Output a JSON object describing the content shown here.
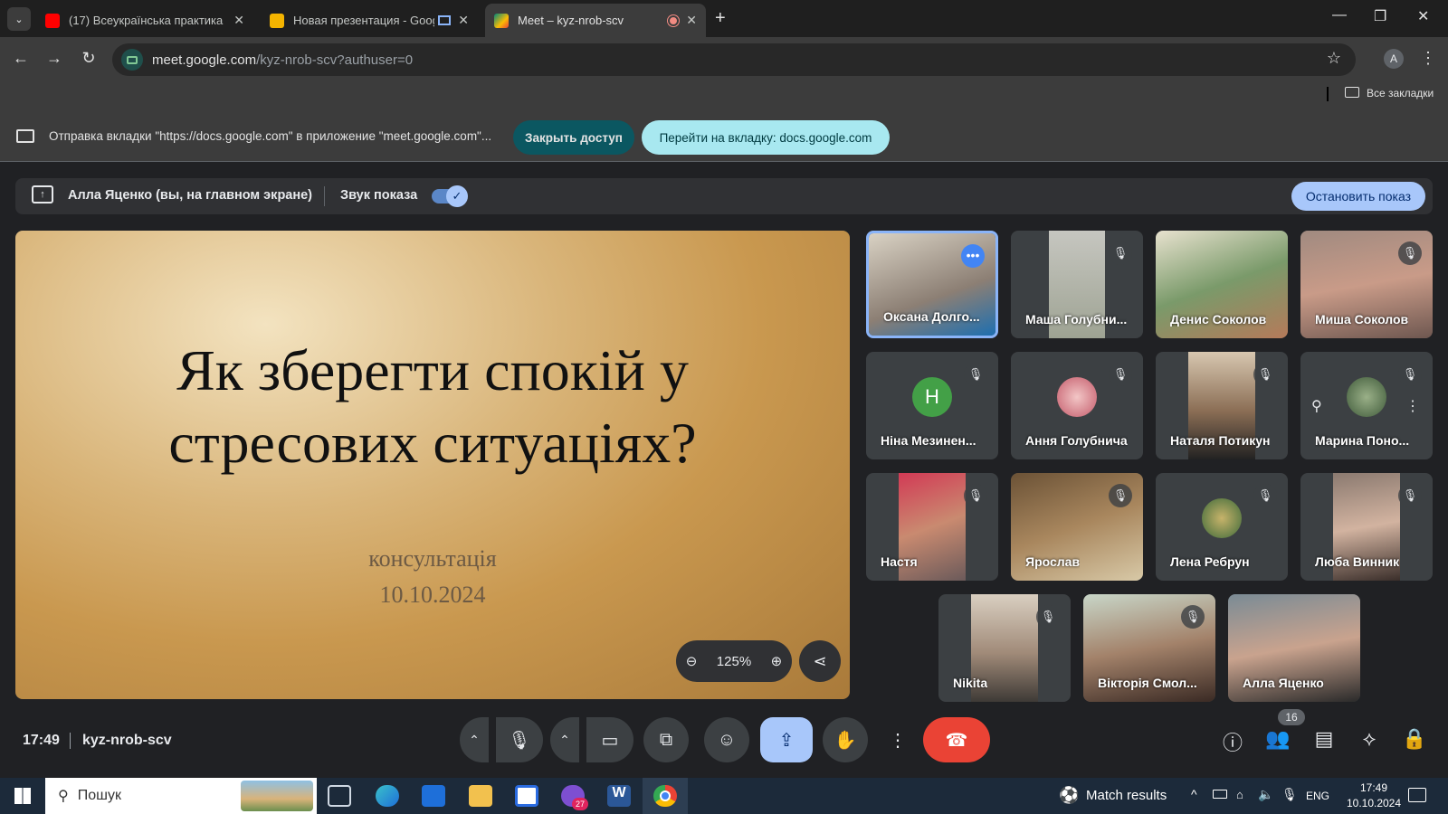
{
  "browser": {
    "tabs": [
      {
        "title": "(17) Всеукраїнська практика «",
        "icon": "youtube-icon",
        "color": "#ff0000"
      },
      {
        "title": "Новая презентация - Goog",
        "icon": "slides-icon",
        "color": "#f4b400"
      },
      {
        "title": "Meet – kyz-nrob-scv",
        "icon": "meet-icon",
        "color": "#00897b"
      }
    ],
    "url_host": "meet.google.com",
    "url_path": "/kyz-nrob-scv?authuser=0",
    "profile_initial": "A",
    "bookmarks_label": "Все закладки"
  },
  "share_banner": {
    "message": "Отправка вкладки \"https://docs.google.com\" в приложение \"meet.google.com\"...",
    "stop_access": "Закрыть доступ",
    "goto_tab": "Перейти на вкладку: docs.google.com"
  },
  "presentation_bar": {
    "presenter": "Алла Яценко (вы, на главном экране)",
    "audio_label": "Звук показа",
    "audio_on": true,
    "stop_button": "Остановить показ"
  },
  "slide": {
    "title_line1": "Як зберегти спокій у",
    "title_line2": "стресових ситуаціях?",
    "subtitle": "консультація",
    "date": "10.10.2024",
    "zoom": "125%"
  },
  "participants": [
    {
      "name": "Оксана Долго...",
      "muted": false,
      "active": true,
      "type": "video"
    },
    {
      "name": "Маша Голубни...",
      "muted": true,
      "type": "video"
    },
    {
      "name": "Денис Соколов",
      "muted": false,
      "type": "video"
    },
    {
      "name": "Миша Соколов",
      "muted": true,
      "type": "video"
    },
    {
      "name": "Ніна Мезинен...",
      "muted": true,
      "type": "avatar",
      "initial": "Н",
      "color": "#43a047"
    },
    {
      "name": "Ання Голубнича",
      "muted": true,
      "type": "avatar-img"
    },
    {
      "name": "Наталя Потикун",
      "muted": true,
      "type": "video"
    },
    {
      "name": "Марина Поно...",
      "muted": true,
      "type": "avatar-img",
      "hover": true
    },
    {
      "name": "Настя",
      "muted": true,
      "type": "video"
    },
    {
      "name": "Ярослав",
      "muted": true,
      "type": "video"
    },
    {
      "name": "Лена Ребрун",
      "muted": true,
      "type": "avatar-img"
    },
    {
      "name": "Люба Винник",
      "muted": true,
      "type": "video"
    },
    {
      "name": "Nikita",
      "muted": true,
      "type": "video"
    },
    {
      "name": "Вікторія Смол...",
      "muted": true,
      "type": "video"
    },
    {
      "name": "Алла Яценко",
      "muted": false,
      "type": "video"
    }
  ],
  "meeting": {
    "time": "17:49",
    "code": "kyz-nrob-scv",
    "people_count": "16"
  },
  "taskbar": {
    "search_placeholder": "Пошук",
    "match_results": "Match results",
    "lang": "ENG",
    "clock_time": "17:49",
    "clock_date": "10.10.2024",
    "viber_badge": "27"
  }
}
